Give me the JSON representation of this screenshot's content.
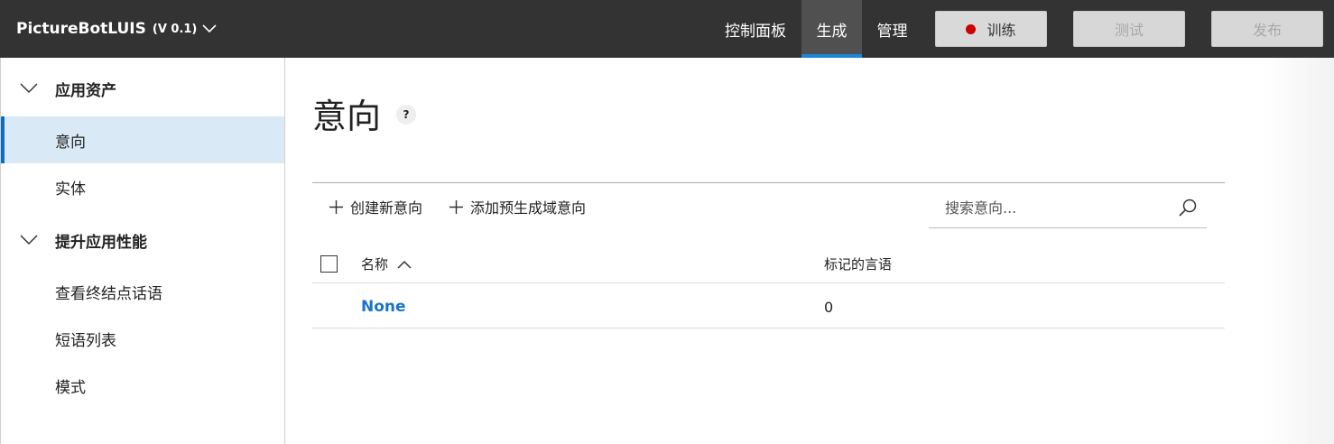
{
  "header": {
    "app_name": "PictureBotLUIS",
    "app_version": "(V 0.1)",
    "nav": {
      "dashboard": "控制面板",
      "build": "生成",
      "manage": "管理"
    },
    "train_label": "训练",
    "test_label": "测试",
    "publish_label": "发布",
    "active_nav": "生成",
    "accent_color": "#1a86d8",
    "train_status_color": "#cc0000"
  },
  "sidebar": {
    "group1": {
      "label": "应用资产",
      "items": [
        "意向",
        "实体"
      ]
    },
    "group2": {
      "label": "提升应用性能",
      "items": [
        "查看终结点话语",
        "短语列表",
        "模式"
      ]
    },
    "active_item": "意向"
  },
  "main": {
    "title": "意向",
    "help_glyph": "?",
    "toolbar": {
      "create_label": "创建新意向",
      "add_prebuilt_label": "添加预生成域意向"
    },
    "search": {
      "placeholder": "搜索意向..."
    },
    "columns": {
      "name": "名称",
      "utterances": "标记的言语"
    },
    "rows": [
      {
        "name": "None",
        "count": "0"
      }
    ]
  }
}
